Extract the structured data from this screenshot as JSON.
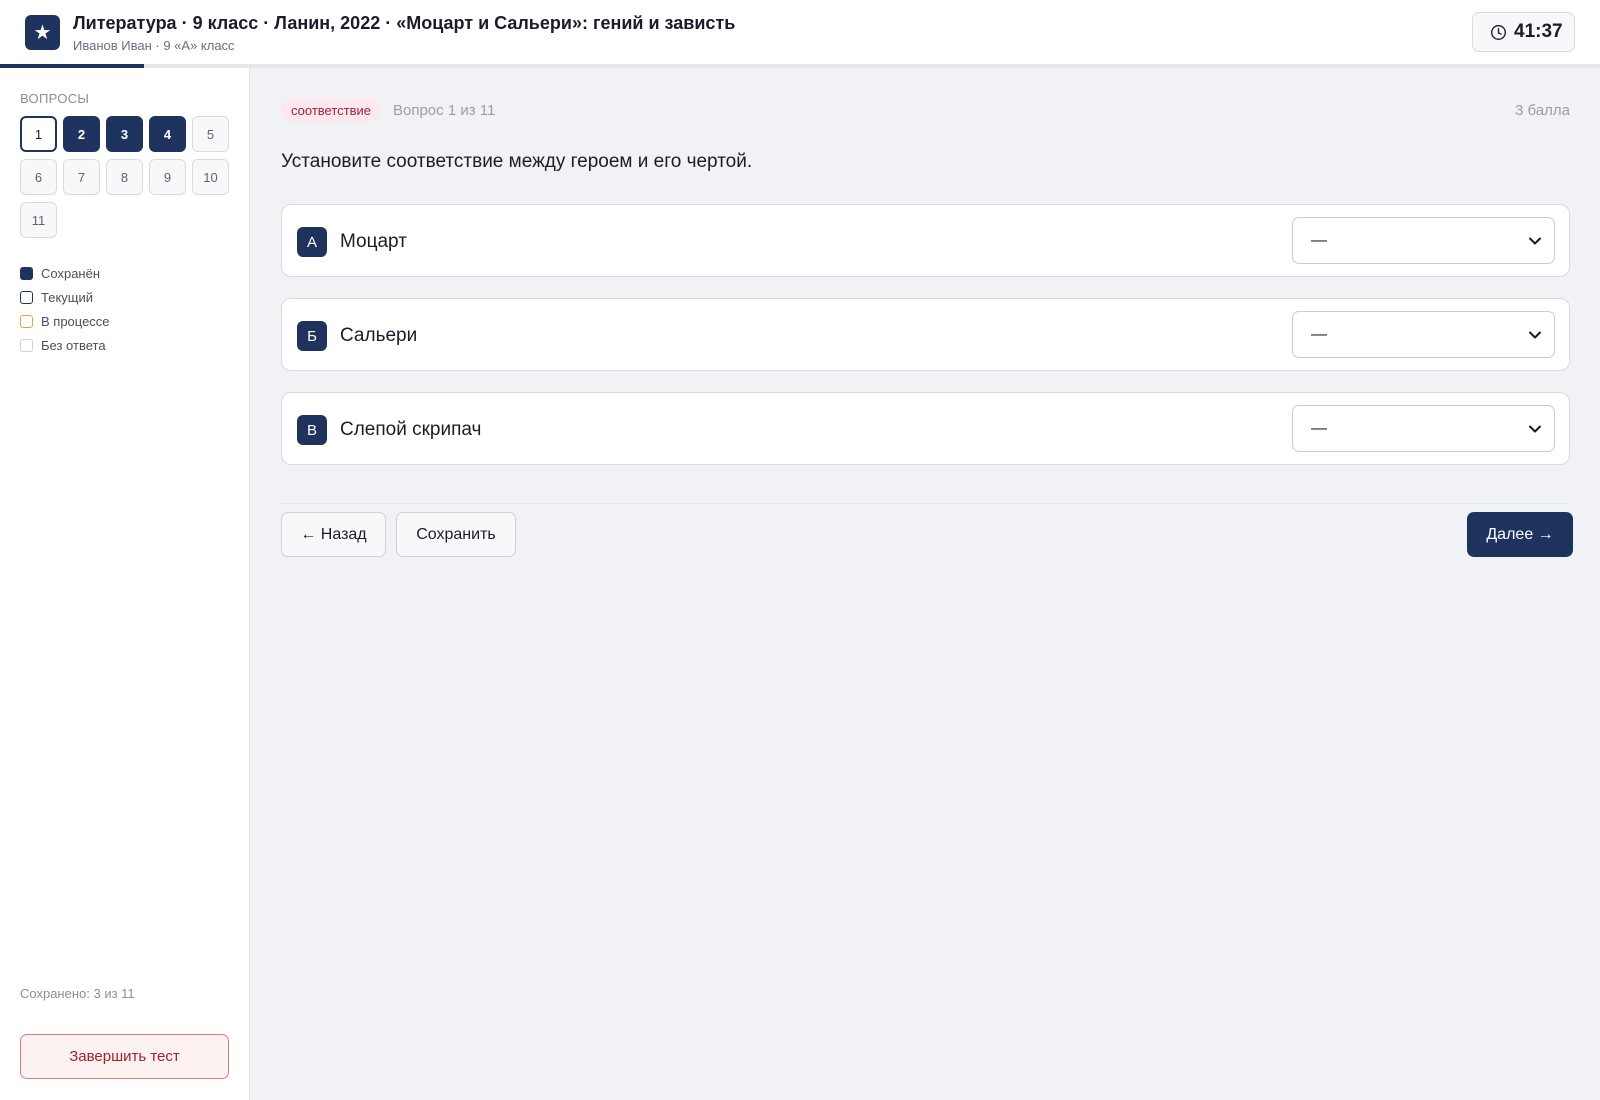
{
  "header": {
    "logo_glyph": "★",
    "title": "Литература · 9 класс · Ланин, 2022 · «Моцарт и Сальери»: гений и зависть",
    "subtitle": "Иванов Иван · 9 «А» класс",
    "timer": "41:37",
    "progress_fraction": 0.09
  },
  "sidebar": {
    "title": "ВОПРОСЫ",
    "questions": [
      {
        "label": "1",
        "status": "current"
      },
      {
        "label": "2",
        "status": "saved"
      },
      {
        "label": "3",
        "status": "saved"
      },
      {
        "label": "4",
        "status": "saved"
      },
      {
        "label": "5",
        "status": "empty"
      },
      {
        "label": "6",
        "status": "empty"
      },
      {
        "label": "7",
        "status": "empty"
      },
      {
        "label": "8",
        "status": "empty"
      },
      {
        "label": "9",
        "status": "empty"
      },
      {
        "label": "10",
        "status": "empty"
      },
      {
        "label": "11",
        "status": "empty"
      }
    ],
    "legend": {
      "saved": "Сохранён",
      "current": "Текущий",
      "in_progress": "В процессе",
      "empty": "Без ответа"
    },
    "saved_count": "Сохранено: 3 из 11",
    "finish_label": "Завершить тест"
  },
  "main": {
    "type_badge": "соответствие",
    "question_number": "Вопрос 1 из 11",
    "points": "3 балла",
    "question_text": "Установите соответствие между героем и его чертой.",
    "rows": [
      {
        "letter": "А",
        "hero": "Моцарт",
        "selected": "—"
      },
      {
        "letter": "Б",
        "hero": "Сальери",
        "selected": "—"
      },
      {
        "letter": "В",
        "hero": "Слепой скрипач",
        "selected": "—"
      }
    ],
    "back_label": "← Назад",
    "save_label": "Сохранить",
    "next_label": "Далее →"
  },
  "colors": {
    "accent": "#1e335e",
    "badge_bg": "#fbe9ee",
    "badge_text": "#a3213f",
    "in_progress": "#e6a53b",
    "danger": "#a3222a"
  }
}
